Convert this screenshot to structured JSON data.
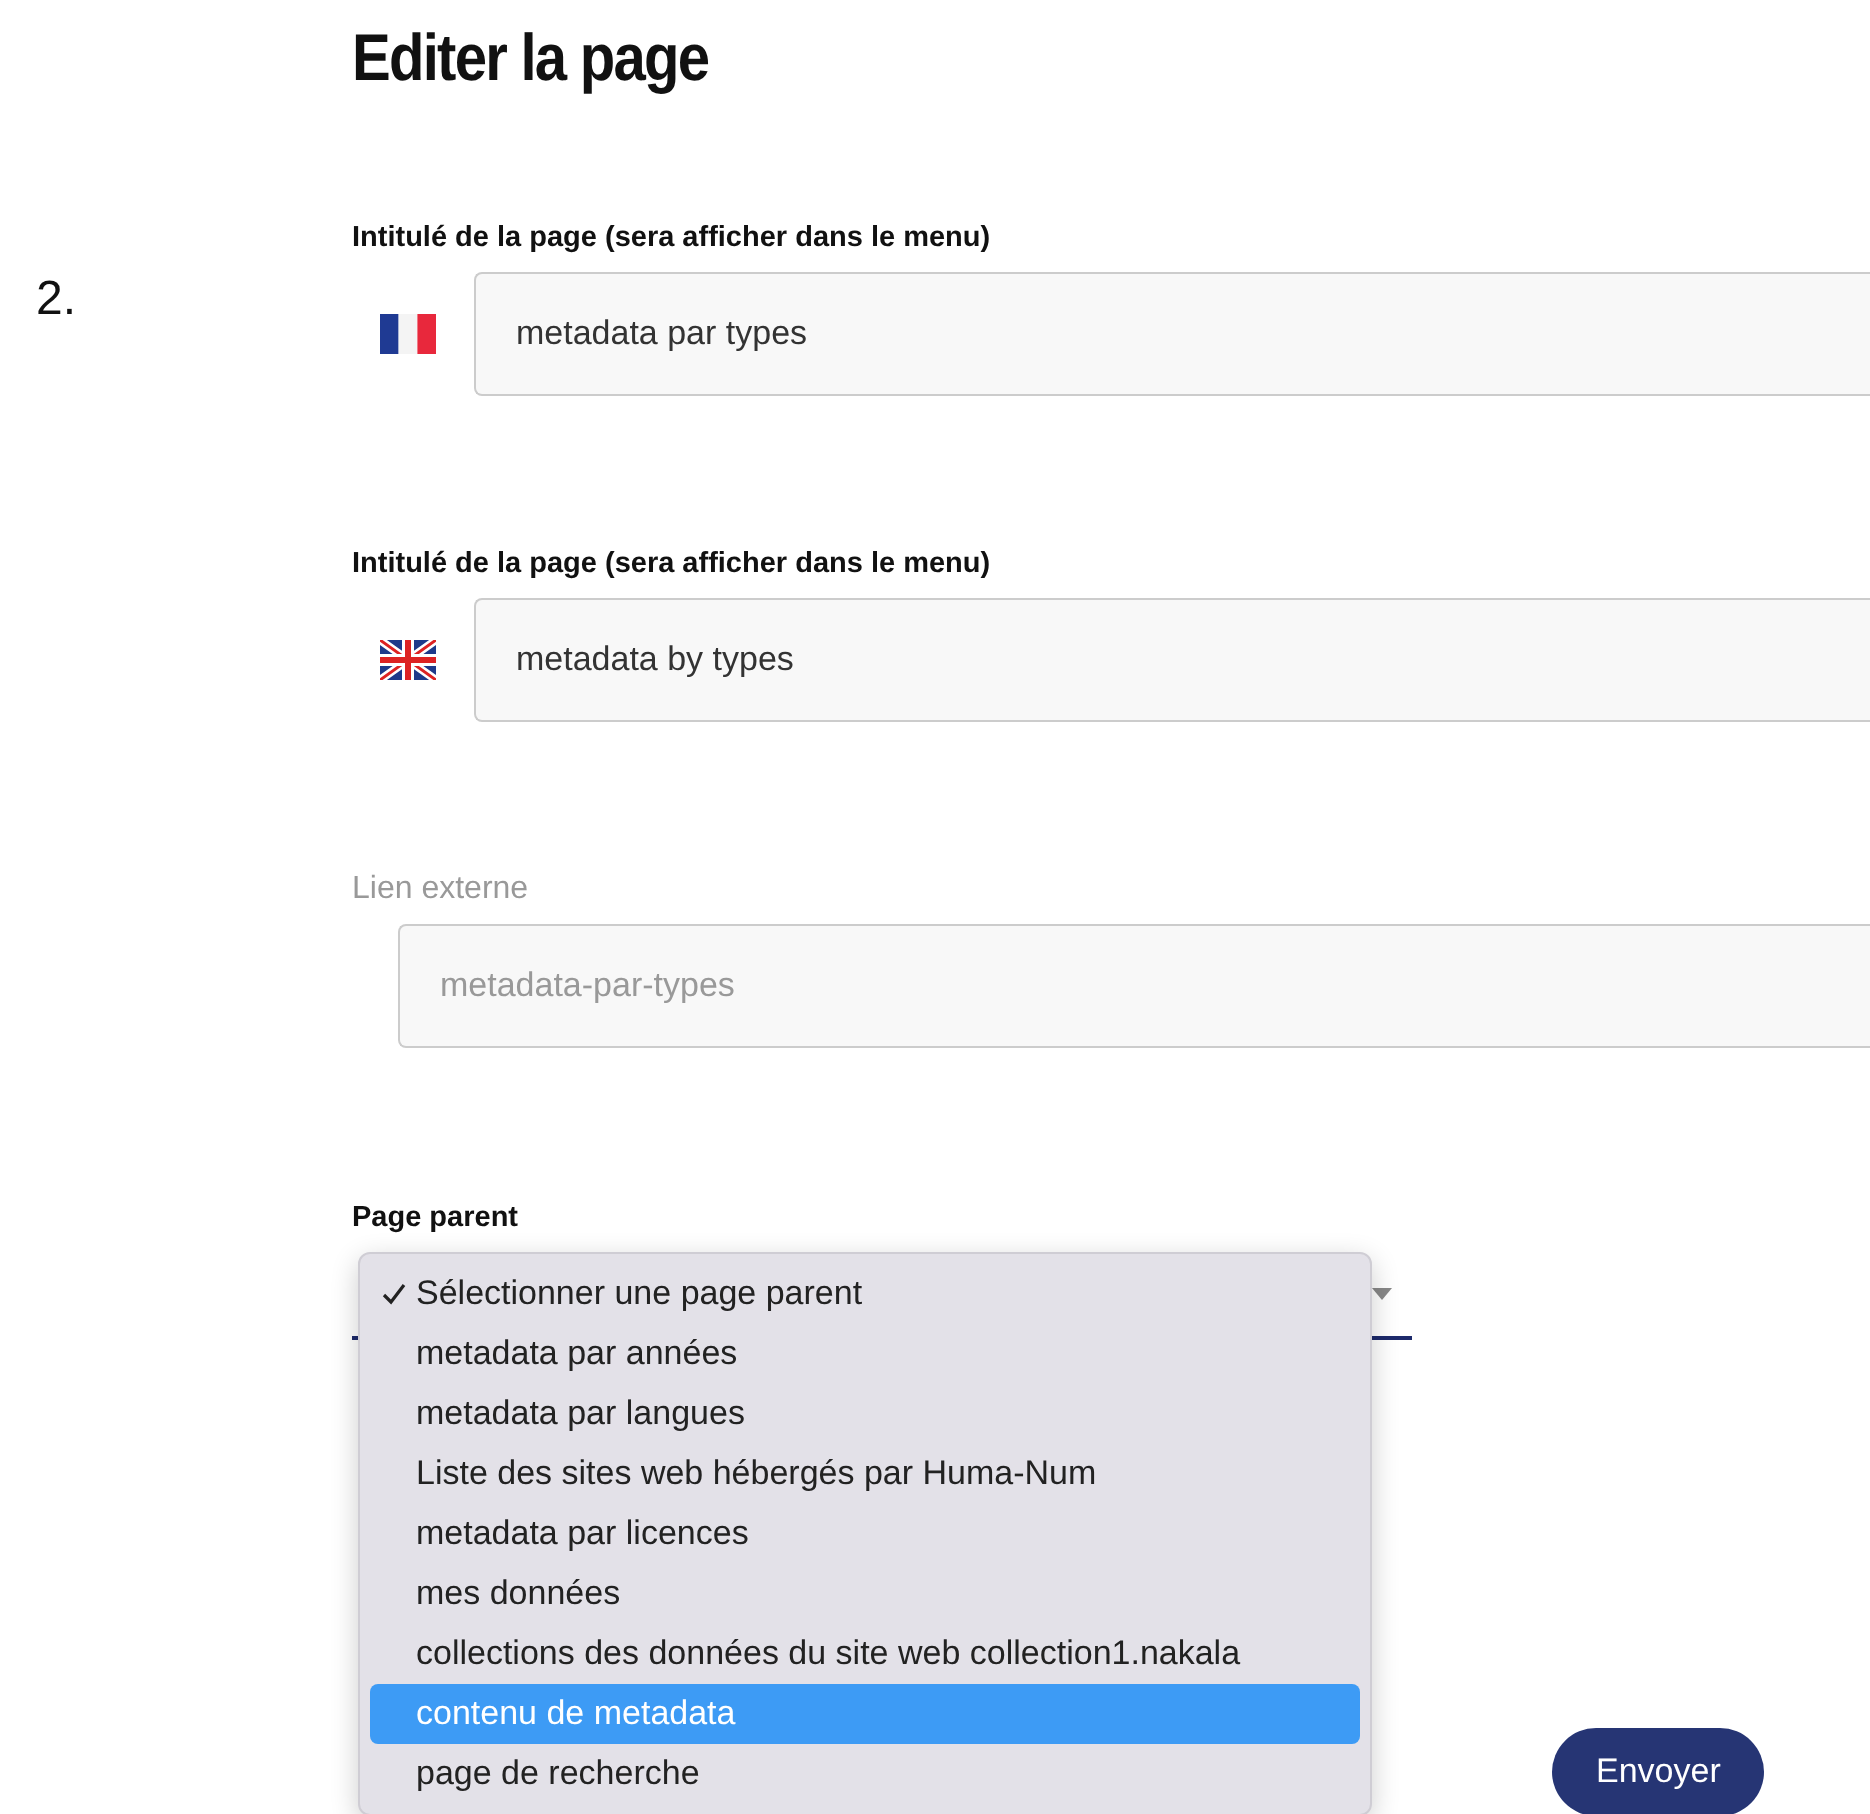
{
  "page_title": "Editer la page",
  "step_number": "2.",
  "fields": [
    {
      "kind": "flag-fr",
      "label": "Intitulé de la page (sera afficher dans le menu)",
      "value": "metadata par types",
      "disabled": false
    },
    {
      "kind": "flag-uk",
      "label": "Intitulé de la page (sera afficher dans le menu)",
      "value": "metadata by types",
      "disabled": false
    },
    {
      "kind": "plain",
      "label": "Lien externe",
      "value": "metadata-par-types",
      "disabled": true
    }
  ],
  "parent_select": {
    "label": "Page parent",
    "options": [
      {
        "label": "Sélectionner une page parent",
        "selected": true,
        "highlighted": false
      },
      {
        "label": "metadata par années",
        "selected": false,
        "highlighted": false
      },
      {
        "label": "metadata par langues",
        "selected": false,
        "highlighted": false
      },
      {
        "label": "Liste des sites web hébergés par Huma-Num",
        "selected": false,
        "highlighted": false
      },
      {
        "label": "metadata par licences",
        "selected": false,
        "highlighted": false
      },
      {
        "label": "mes données",
        "selected": false,
        "highlighted": false
      },
      {
        "label": "collections des données du site web collection1.nakala",
        "selected": false,
        "highlighted": false
      },
      {
        "label": "contenu de metadata",
        "selected": false,
        "highlighted": true
      },
      {
        "label": "page de recherche",
        "selected": false,
        "highlighted": false
      }
    ]
  },
  "submit_button": "Envoyer"
}
